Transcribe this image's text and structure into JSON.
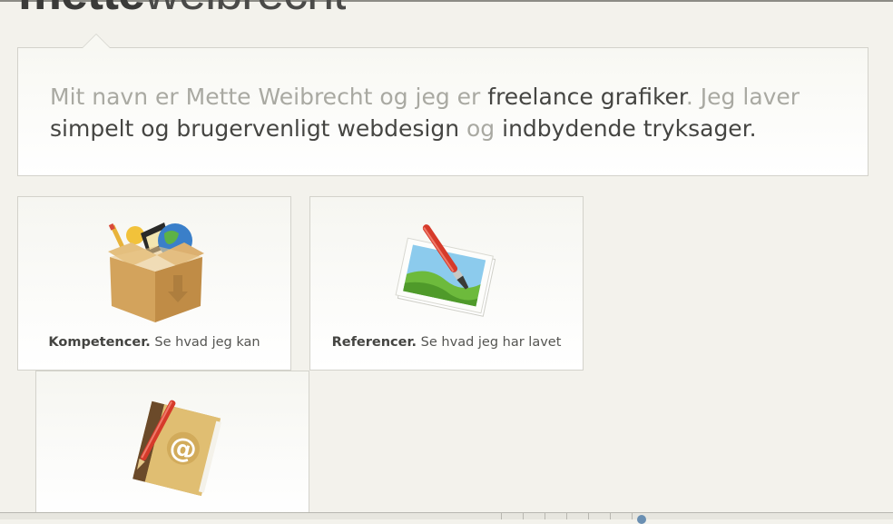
{
  "header": {
    "logo_bold": "mette",
    "logo_light": "weibrecht"
  },
  "intro": {
    "parts": [
      {
        "text": "Mit navn er Mette Weibrecht og jeg er ",
        "highlight": false
      },
      {
        "text": "freelance grafiker",
        "highlight": true
      },
      {
        "text": ". Jeg laver ",
        "highlight": false
      },
      {
        "text": "simpelt og brugervenligt webdesign",
        "highlight": true
      },
      {
        "text": " og ",
        "highlight": false
      },
      {
        "text": "indbydende tryksager",
        "highlight": true
      },
      {
        "text": ".",
        "highlight": true
      }
    ]
  },
  "cards": [
    {
      "title": "Kompetencer.",
      "subtitle": " Se hvad jeg kan",
      "icon": "box-with-tools-icon"
    },
    {
      "title": "Referencer.",
      "subtitle": " Se hvad jeg har lavet",
      "icon": "picture-with-brush-icon"
    },
    {
      "title": "",
      "subtitle": "",
      "icon": "address-book-icon"
    }
  ],
  "colors": {
    "background": "#f3f2ec",
    "text_dark": "#454542",
    "text_light": "#a9a9a2",
    "border": "#d3d2cb"
  }
}
